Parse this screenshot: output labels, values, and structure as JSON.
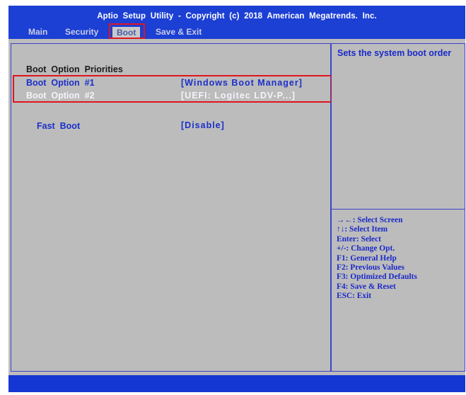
{
  "header": {
    "title": "Aptio  Setup  Utility  -  Copyright  (c)  2018  American  Megatrends.  Inc.",
    "tabs": [
      {
        "label": "Main"
      },
      {
        "label": "Security"
      },
      {
        "label": "Boot",
        "selected": true
      },
      {
        "label": "Save & Exit"
      }
    ]
  },
  "boot": {
    "section_heading": "Boot  Option  Priorities",
    "options": [
      {
        "label": "Boot  Option  #1",
        "value": "[Windows Boot Manager]"
      },
      {
        "label": "Boot  Option  #2",
        "value": "[UEFI: Logitec LDV-P...]"
      }
    ],
    "fast_boot": {
      "label": "Fast  Boot",
      "value": "[Disable]"
    }
  },
  "help": {
    "description": "Sets the system boot order",
    "keys": [
      "→←: Select Screen",
      "↑↓: Select Item",
      "Enter: Select",
      "+/-: Change Opt.",
      "F1: General Help",
      "F2: Previous Values",
      "F3: Optimized Defaults",
      "F4: Save & Reset",
      "ESC: Exit"
    ]
  },
  "colors": {
    "bios_blue": "#0d2bc9",
    "panel_gray": "#bcbcbc",
    "highlight_red": "#e0151e"
  }
}
